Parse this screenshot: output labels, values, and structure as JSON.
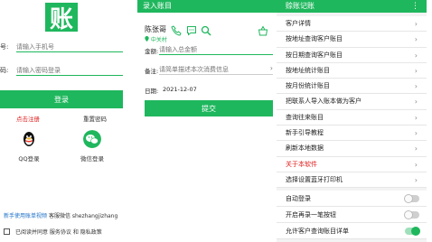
{
  "login": {
    "logo_char": "账",
    "phone_label": "号:",
    "phone_placeholder": "请输入手机号",
    "password_label": "码:",
    "password_placeholder": "请输入密码登录",
    "login_button": "登录",
    "register_link": "点击注册",
    "reset_link": "重置密码",
    "qq_label": "QQ登录",
    "wechat_label": "微信登录",
    "tutorial_link": "新手使用账单视频",
    "wechat_account": "客服微信 shezhangjizhang",
    "agree_text": "已阅读并同意 服务协议 和 隐私政策"
  },
  "entry": {
    "title": "录入账目",
    "customer_name": "陈张哥",
    "location": "中关村",
    "amount_label": "金额:",
    "amount_placeholder": "请输入总金额",
    "note_label": "备注:",
    "note_placeholder": "请简单描述本次消费信息",
    "date_label": "日期:",
    "date_value": "2021-12-07",
    "submit_button": "提交"
  },
  "menu": {
    "title": "赊账记账",
    "items": [
      {
        "label": "客户详情",
        "red": false
      },
      {
        "label": "按地址查询客户账目",
        "red": false
      },
      {
        "label": "按日期查询客户账目",
        "red": false
      },
      {
        "label": "按地址统计账目",
        "red": false
      },
      {
        "label": "按月份统计账目",
        "red": false
      },
      {
        "label": "把联系人导入账本做为客户",
        "red": false
      },
      {
        "label": "查询往来账目",
        "red": false
      },
      {
        "label": "新手引导教程",
        "red": false
      },
      {
        "label": "刷新本地数据",
        "red": false
      },
      {
        "label": "关于本软件",
        "red": true
      },
      {
        "label": "选择设置蓝牙打印机",
        "red": false
      }
    ],
    "switches": [
      {
        "label": "自动登录",
        "on": false
      },
      {
        "label": "开启再录一笔按钮",
        "on": false
      },
      {
        "label": "允许客户查询账目详单",
        "on": true
      }
    ]
  },
  "colors": {
    "brand_green": "#1fb75d",
    "link_red": "#e02020",
    "link_blue": "#1a6fc7"
  }
}
